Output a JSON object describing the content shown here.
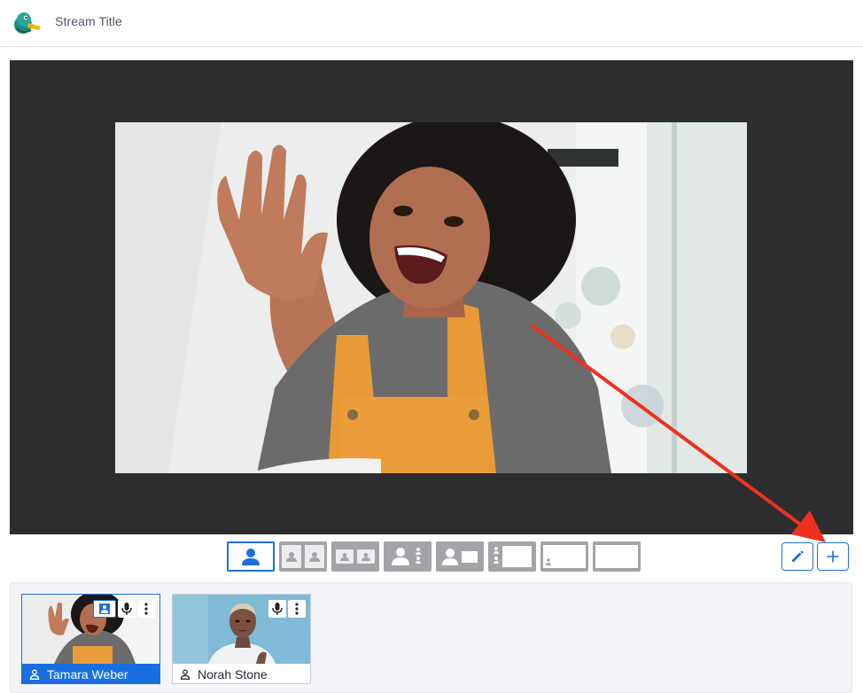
{
  "header": {
    "title": "Stream Title",
    "logo_icon": "duck-logo-icon"
  },
  "stage": {
    "background_color": "#2d2d30",
    "featured_participant": "Tamara Weber"
  },
  "layouts": {
    "selected_index": 0,
    "options": [
      "solo",
      "two-up",
      "two-up-small",
      "person-plus-stack",
      "person-plus-screen",
      "stack-plus-screen",
      "screen-with-pip",
      "screen-only"
    ]
  },
  "actions": {
    "edit_icon": "pencil-icon",
    "add_icon": "plus-icon"
  },
  "participants": [
    {
      "name": "Tamara Weber",
      "on_stage": true
    },
    {
      "name": "Norah Stone",
      "on_stage": false
    }
  ],
  "colors": {
    "accent": "#1a6fe0",
    "annotation": "#f0301e"
  }
}
